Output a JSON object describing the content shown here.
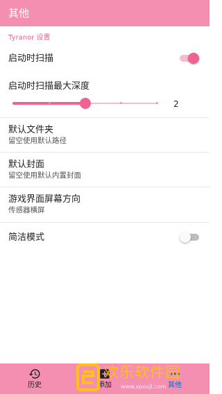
{
  "app": {
    "title": "其他"
  },
  "section": {
    "header": "Tyranor 设置"
  },
  "settings": {
    "scan_on_start": {
      "label": "启动时扫描",
      "enabled": true
    },
    "scan_depth": {
      "label": "启动时扫描最大深度",
      "value": "2",
      "fraction": 0.5
    },
    "default_folder": {
      "label": "默认文件夹",
      "summary": "留空使用默认路径"
    },
    "default_cover": {
      "label": "默认封面",
      "summary": "留空使用默认内置封面"
    },
    "orientation": {
      "label": "游戏界面屏幕方向",
      "summary": "传感器横屏"
    },
    "simple_mode": {
      "label": "简洁模式",
      "enabled": false
    }
  },
  "bottom_nav": {
    "history": {
      "label": "历史",
      "icon": "history-icon"
    },
    "add": {
      "label": "添加",
      "icon": "add-icon"
    },
    "other": {
      "label": "其他",
      "icon": "more-icon",
      "active": true
    }
  },
  "watermark": {
    "text": "欢乐软件园",
    "url": "www.xpoujl.com"
  },
  "colors": {
    "accent": "#f48fb1",
    "accent_dark": "#f06292",
    "active_nav": "#1565c0"
  }
}
